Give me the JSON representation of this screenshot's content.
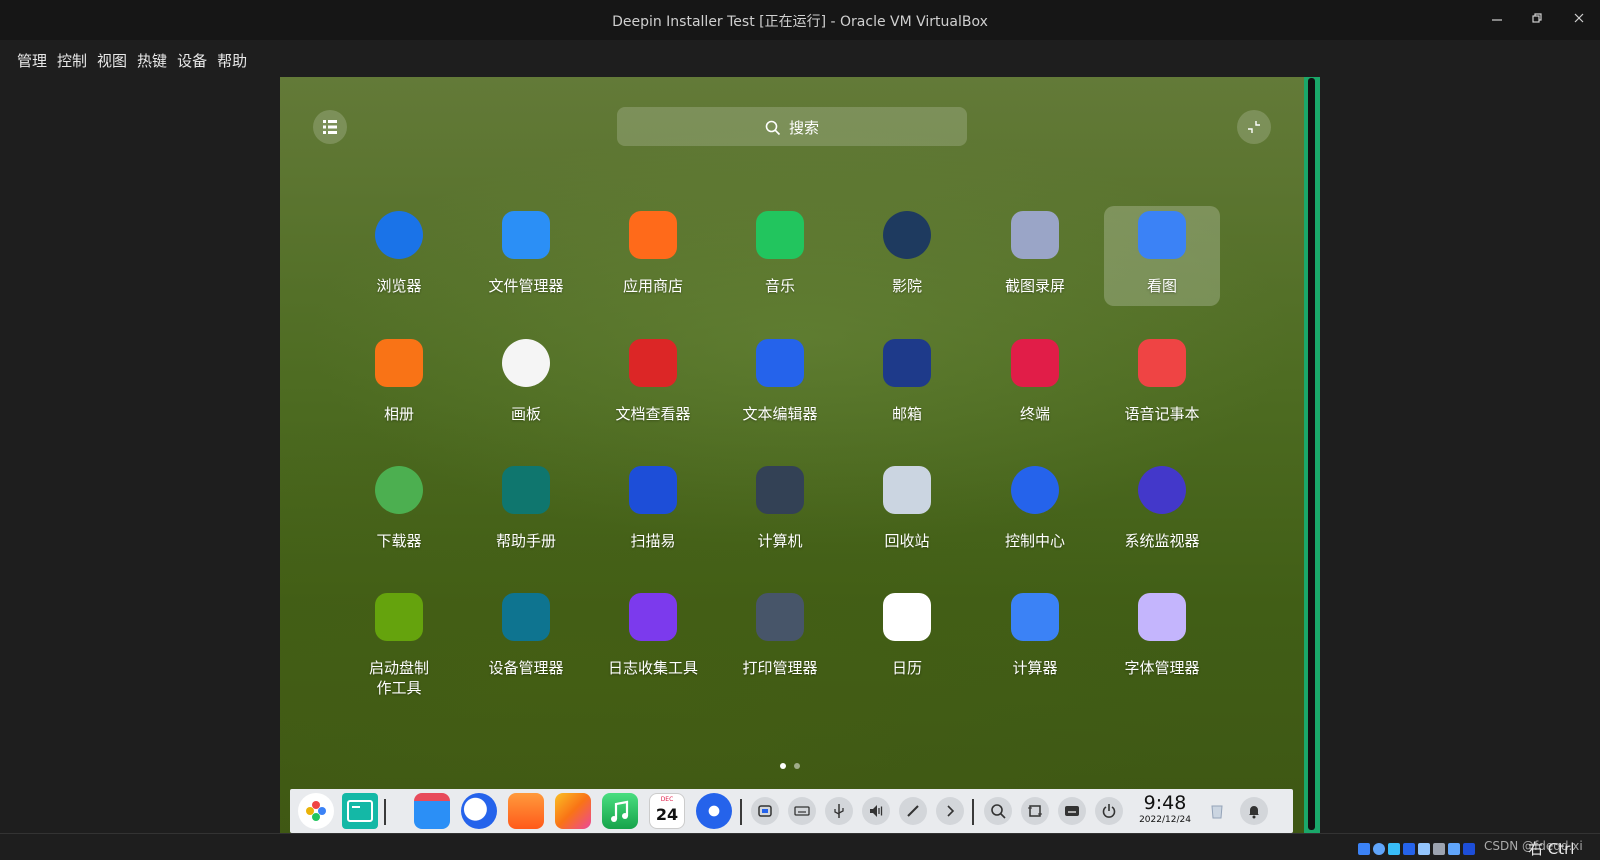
{
  "window": {
    "title": "Deepin Installer Test [正在运行] - Oracle VM VirtualBox",
    "controls": [
      "minimize",
      "restore",
      "close"
    ]
  },
  "menubar": {
    "items": [
      "管理",
      "控制",
      "视图",
      "热键",
      "设备",
      "帮助"
    ]
  },
  "launcher": {
    "search_placeholder": "搜索",
    "apps": [
      {
        "label": "浏览器",
        "icon": "browser-icon",
        "color": "#1a73e8"
      },
      {
        "label": "文件管理器",
        "icon": "file-manager-icon",
        "color": "#2b8ff6"
      },
      {
        "label": "应用商店",
        "icon": "app-store-icon",
        "color": "#ff6a1a"
      },
      {
        "label": "音乐",
        "icon": "music-icon",
        "color": "#22c55e"
      },
      {
        "label": "影院",
        "icon": "movie-icon",
        "color": "#1e3a5f"
      },
      {
        "label": "截图录屏",
        "icon": "screenshot-icon",
        "color": "#9aa5c7"
      },
      {
        "label": "看图",
        "icon": "image-viewer-icon",
        "color": "#3b82f6"
      },
      {
        "label": "相册",
        "icon": "album-icon",
        "color": "#f97316"
      },
      {
        "label": "画板",
        "icon": "draw-icon",
        "color": "#f5f5f5"
      },
      {
        "label": "文档查看器",
        "icon": "document-viewer-icon",
        "color": "#dc2626"
      },
      {
        "label": "文本编辑器",
        "icon": "text-editor-icon",
        "color": "#2563eb"
      },
      {
        "label": "邮箱",
        "icon": "mail-icon",
        "color": "#1e3a8a"
      },
      {
        "label": "终端",
        "icon": "terminal-icon",
        "color": "#e11d48"
      },
      {
        "label": "语音记事本",
        "icon": "voice-note-icon",
        "color": "#ef4444"
      },
      {
        "label": "下载器",
        "icon": "downloader-icon",
        "color": "#4caf50"
      },
      {
        "label": "帮助手册",
        "icon": "help-manual-icon",
        "color": "#0f766e"
      },
      {
        "label": "扫描易",
        "icon": "scanner-icon",
        "color": "#1d4ed8"
      },
      {
        "label": "计算机",
        "icon": "computer-icon",
        "color": "#334155"
      },
      {
        "label": "回收站",
        "icon": "trash-icon",
        "color": "#cbd5e1"
      },
      {
        "label": "控制中心",
        "icon": "control-center-icon",
        "color": "#2563eb"
      },
      {
        "label": "系统监视器",
        "icon": "system-monitor-icon",
        "color": "#4338ca"
      },
      {
        "label": "启动盘制作工具",
        "icon": "boot-maker-icon",
        "color": "#65a30d"
      },
      {
        "label": "设备管理器",
        "icon": "device-manager-icon",
        "color": "#0e7490"
      },
      {
        "label": "日志收集工具",
        "icon": "log-collector-icon",
        "color": "#7c3aed"
      },
      {
        "label": "打印管理器",
        "icon": "print-manager-icon",
        "color": "#475569"
      },
      {
        "label": "日历",
        "icon": "calendar-icon",
        "color": "#ffffff"
      },
      {
        "label": "计算器",
        "icon": "calculator-icon",
        "color": "#3b82f6"
      },
      {
        "label": "字体管理器",
        "icon": "font-manager-icon",
        "color": "#c4b5fd"
      }
    ],
    "selected_app": "看图",
    "pages": 2,
    "current_page": 1
  },
  "dock": {
    "apps": [
      {
        "icon": "launcher-icon",
        "color": "#ffffff"
      },
      {
        "icon": "multitask-view-icon",
        "color": "#14b8a6"
      },
      {
        "icon": "file-manager-icon",
        "color": "#2b8ff6"
      },
      {
        "icon": "browser-icon",
        "color": "#1a73e8"
      },
      {
        "icon": "app-store-icon",
        "color": "#ff6a1a"
      },
      {
        "icon": "album-icon",
        "color": "#f97316"
      },
      {
        "icon": "music-icon",
        "color": "#22c55e"
      },
      {
        "icon": "calendar-icon",
        "color": "#ffffff"
      },
      {
        "icon": "control-center-icon",
        "color": "#2563eb"
      }
    ],
    "tray": [
      "screenshot-icon",
      "keyboard-icon",
      "usb-icon",
      "volume-icon",
      "pen-icon",
      "chevron-right-icon",
      "search-icon",
      "capture-icon",
      "onscreen-keyboard-icon",
      "power-icon"
    ],
    "clock_time": "9:48",
    "clock_date": "2022/12/24",
    "calendar_day": "24",
    "calendar_month": "DEC"
  },
  "statusbar": {
    "host_key": "右 Ctrl",
    "watermark": "CSDN @fdeqd.xi"
  }
}
